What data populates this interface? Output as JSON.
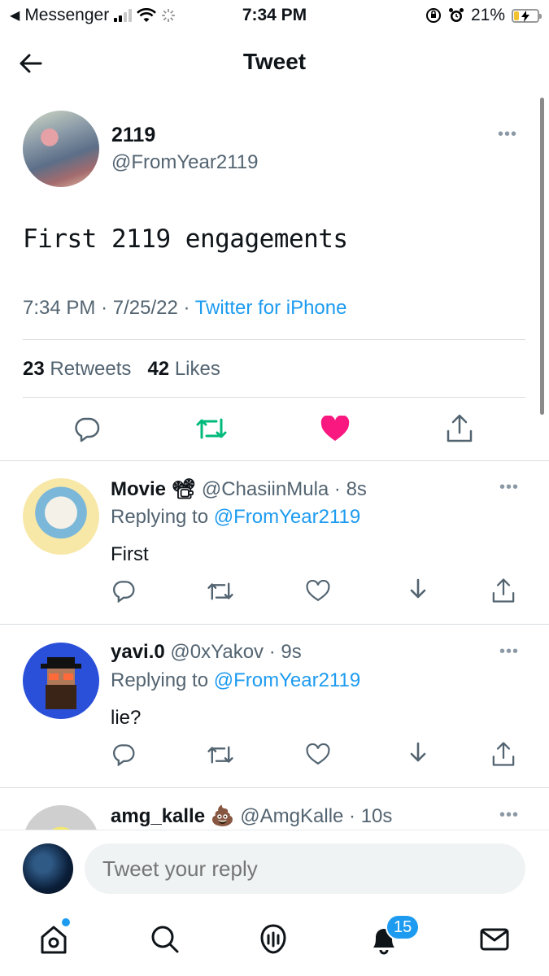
{
  "status_bar": {
    "back_app": "Messenger",
    "time": "7:34 PM",
    "battery": "21%",
    "battery_level": 0.21
  },
  "header": {
    "title": "Tweet"
  },
  "main_tweet": {
    "name": "2119",
    "handle": "@FromYear2119",
    "text": "First 2119 engagements",
    "time": "7:34 PM",
    "date": "7/25/22",
    "source": "Twitter for iPhone",
    "retweets_count": "23",
    "retweets_label": "Retweets",
    "likes_count": "42",
    "likes_label": "Likes",
    "liked": true,
    "colors": {
      "retweet": "#00ba7c",
      "like": "#f91880",
      "link": "#1d9bf0"
    }
  },
  "replies": [
    {
      "name": "Movie 📽",
      "handle": "@ChasiinMula · 8s",
      "replying_label": "Replying to",
      "replying_to": "@FromYear2119",
      "text": "First"
    },
    {
      "name": "yavi.0",
      "handle": "@0xYakov · 9s",
      "replying_label": "Replying to",
      "replying_to": "@FromYear2119",
      "text": "lie?"
    },
    {
      "name": "amg_kalle 💩",
      "handle": "@AmgKalle · 10s"
    }
  ],
  "compose": {
    "placeholder": "Tweet your reply"
  },
  "tabbar": {
    "items": [
      "home-icon",
      "search-icon",
      "spaces-icon",
      "notifications-icon",
      "messages-icon"
    ],
    "notifications_badge": "15"
  }
}
